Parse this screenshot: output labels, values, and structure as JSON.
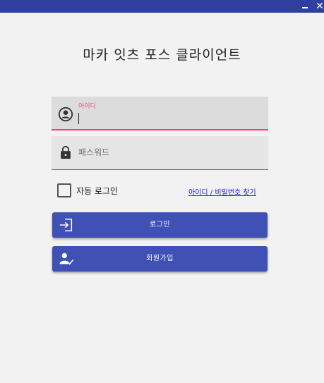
{
  "window": {
    "minimize_glyph": "",
    "close_glyph": "✕"
  },
  "app": {
    "title": "마카 잇츠 포스 클라이언트"
  },
  "login_form": {
    "id_field": {
      "label": "아이디",
      "value": "",
      "icon": "account-circle-icon"
    },
    "password_field": {
      "placeholder": "패스워드",
      "value": "",
      "icon": "lock-icon"
    },
    "auto_login": {
      "label": "자동 로그인",
      "checked": false
    },
    "find_link": "아이디 / 비밀번호 찾기",
    "login_button": {
      "label": "로그인",
      "icon": "login-icon"
    },
    "signup_button": {
      "label": "회원가입",
      "icon": "person-check-icon"
    }
  },
  "colors": {
    "titlebar": "#2f3fa0",
    "primary": "#3f51b5",
    "accent": "#e8467a",
    "background": "#f2f2f2",
    "link": "#1a1ac8"
  }
}
